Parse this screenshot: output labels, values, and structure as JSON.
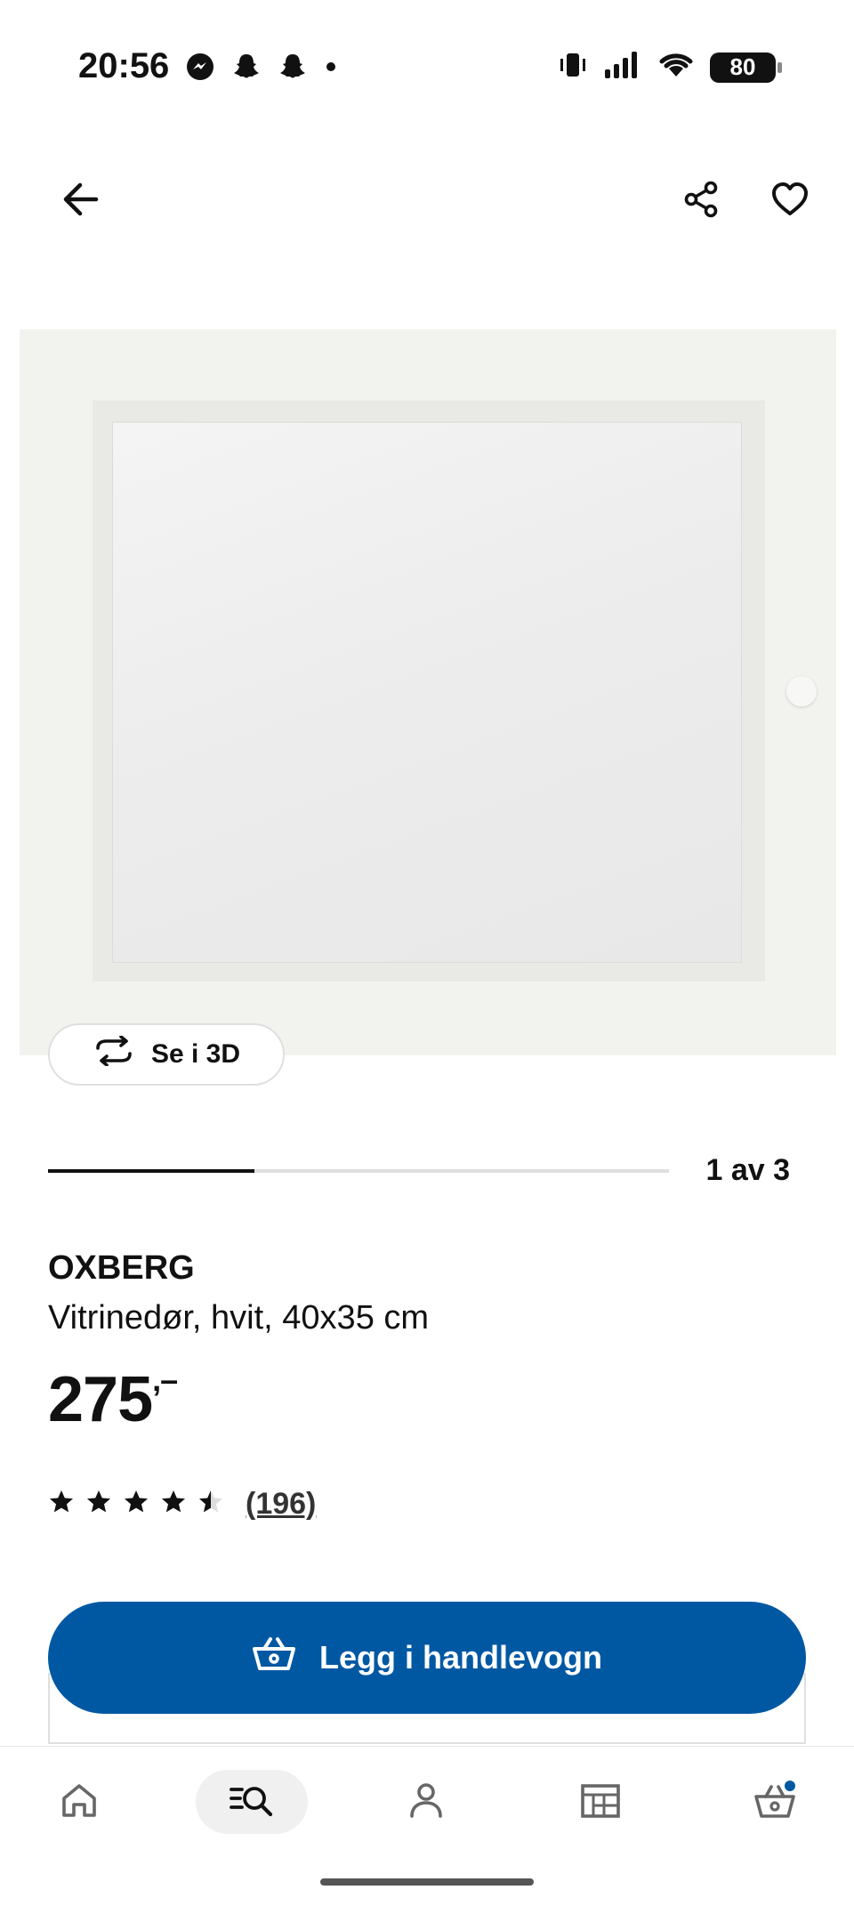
{
  "status_bar": {
    "time": "20:56",
    "battery": "80",
    "app_icons": [
      "messenger-icon",
      "snapchat-icon",
      "snapchat-icon",
      "dot-icon"
    ]
  },
  "top_nav": {
    "back_icon": "arrow-left-icon",
    "share_icon": "share-icon",
    "favorite_icon": "heart-icon"
  },
  "gallery": {
    "see_3d_label": "Se i 3D",
    "page_label": "1 av 3",
    "progress_fraction": 0.333
  },
  "product": {
    "name": "OXBERG",
    "description": "Vitrinedør, hvit, 40x35 cm",
    "price": "275",
    "price_suffix": ",–",
    "rating_value": 4.5,
    "rating_count": "(196)"
  },
  "actions": {
    "add_to_cart_label": "Legg i handlevogn"
  },
  "bottom_nav": {
    "items": [
      "home-icon",
      "search-icon",
      "profile-icon",
      "store-icon",
      "cart-icon"
    ],
    "active": "search-icon"
  },
  "colors": {
    "accent": "#0058a3",
    "text": "#111111",
    "cart_badge": "#0058a3"
  }
}
